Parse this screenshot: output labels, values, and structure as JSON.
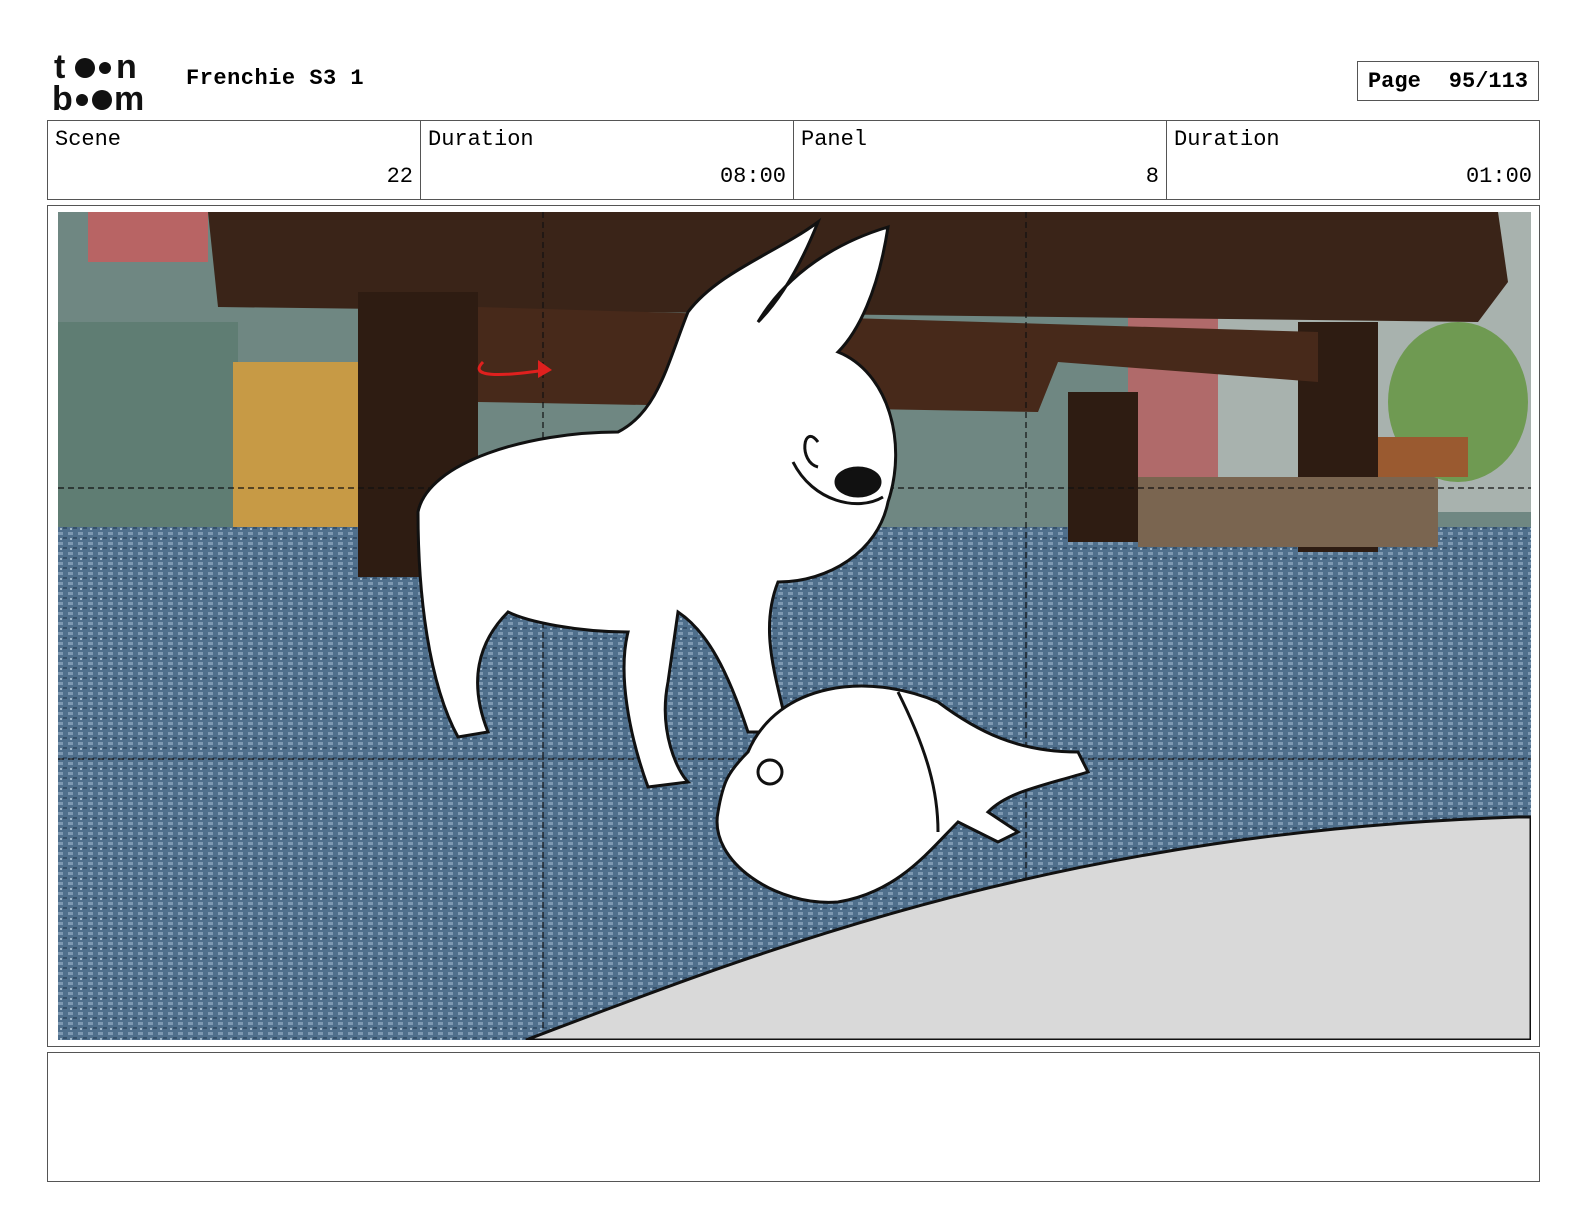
{
  "header": {
    "logo_text": "toon boom",
    "project_title": "Frenchie S3 1",
    "page_label": "Page",
    "page_number": "95/113"
  },
  "info_row": {
    "scene_label": "Scene",
    "scene_value": "22",
    "scene_duration_label": "Duration",
    "scene_duration_value": "08:00",
    "panel_label": "Panel",
    "panel_value": "8",
    "panel_duration_label": "Duration",
    "panel_duration_value": "01:00"
  },
  "panel": {
    "icons": [
      "camera-move-arrow-icon"
    ],
    "colors": {
      "rug": "#4f6f8c",
      "table": "#3a2418",
      "wall": "#5f7d73",
      "sketch_fill": "#ffffff",
      "arrow": "#e0201e",
      "foreground": "#d9d9d9"
    }
  },
  "notes": {
    "text": ""
  }
}
